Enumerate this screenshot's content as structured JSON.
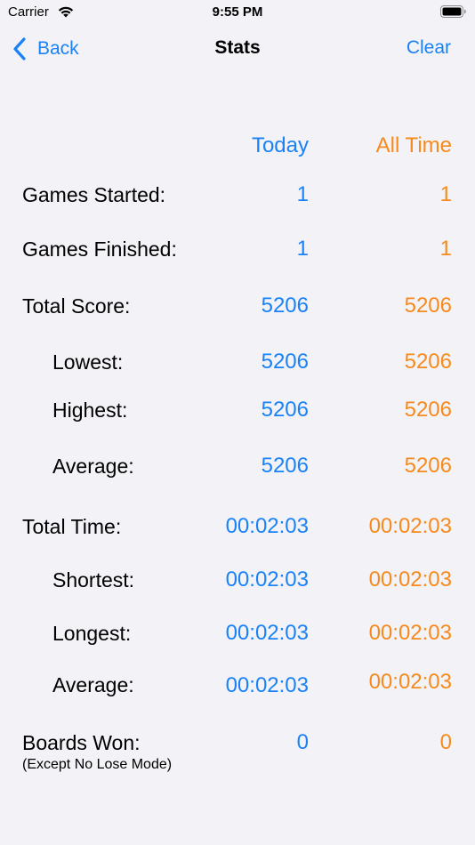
{
  "status_bar": {
    "carrier": "Carrier",
    "time": "9:55 PM",
    "wifi_icon": "wifi-icon",
    "battery_icon": "battery-icon"
  },
  "nav": {
    "back_label": "Back",
    "title": "Stats",
    "clear_label": "Clear"
  },
  "columns": {
    "today": "Today",
    "all_time": "All Time"
  },
  "colors": {
    "today": "#1a82f6",
    "all_time": "#f78a1c",
    "background": "#f2f2f7"
  },
  "stats": {
    "games_started": {
      "label": "Games Started:",
      "today": "1",
      "all_time": "1"
    },
    "games_finished": {
      "label": "Games Finished:",
      "today": "1",
      "all_time": "1"
    },
    "total_score": {
      "label": "Total Score:",
      "today": "5206",
      "all_time": "5206"
    },
    "lowest": {
      "label": "Lowest:",
      "today": "5206",
      "all_time": "5206"
    },
    "highest": {
      "label": "Highest:",
      "today": "5206",
      "all_time": "5206"
    },
    "average_score": {
      "label": "Average:",
      "today": "5206",
      "all_time": "5206"
    },
    "total_time": {
      "label": "Total Time:",
      "today": "00:02:03",
      "all_time": "00:02:03"
    },
    "shortest": {
      "label": "Shortest:",
      "today": "00:02:03",
      "all_time": "00:02:03"
    },
    "longest": {
      "label": "Longest:",
      "today": "00:02:03",
      "all_time": "00:02:03"
    },
    "average_time": {
      "label": "Average:",
      "today": "00:02:03",
      "all_time": "00:02:03"
    },
    "boards_won": {
      "label": "Boards Won:",
      "note": "(Except No Lose Mode)",
      "today": "0",
      "all_time": "0"
    }
  }
}
